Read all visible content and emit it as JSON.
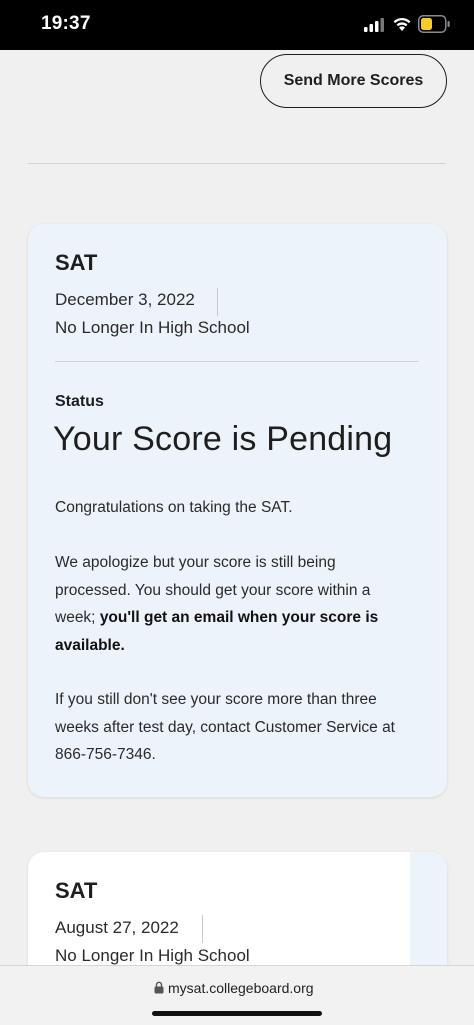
{
  "status_bar": {
    "time": "19:37",
    "icons": [
      "signal-icon",
      "wifi-icon",
      "battery-icon"
    ],
    "battery_color": "#f5cc2e"
  },
  "header": {
    "send_more_scores_label": "Send More Scores"
  },
  "cards": [
    {
      "test": "SAT",
      "date": "December 3, 2022",
      "grade": "No Longer In High School",
      "status_label": "Status",
      "status_title": "Your Score is Pending",
      "paragraph_1": "Congratulations on taking the SAT.",
      "paragraph_2_normal": "We apologize but your score is still being processed. You should get your score within a week; ",
      "paragraph_2_bold": "you'll get an email when your score is available.",
      "paragraph_3": "If you still don't see your score more than three weeks after test day, contact Customer Service at 866-756-7346."
    },
    {
      "test": "SAT",
      "date": "August 27, 2022",
      "grade": "No Longer In High School"
    }
  ],
  "browser": {
    "url": "mysat.collegeboard.org",
    "lock_icon": "lock-icon"
  },
  "colors": {
    "card_background": "#edf3fb",
    "page_background": "#f0f0f0",
    "text": "#1e1e1e"
  }
}
